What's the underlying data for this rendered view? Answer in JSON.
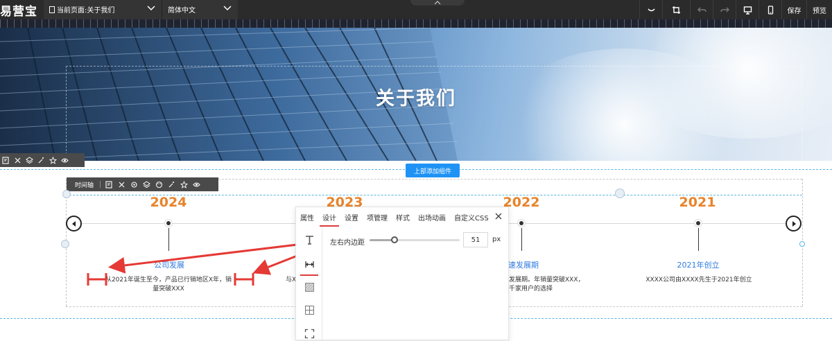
{
  "toolbar": {
    "logo": "易营宝",
    "current_page": "当前页面:关于我们",
    "language": "简体中文",
    "save": "保存",
    "preview": "预览",
    "tools": [
      "collapse-icon",
      "crop-icon",
      "undo-icon",
      "redo-icon",
      "desktop-icon",
      "mobile-icon"
    ]
  },
  "banner": {
    "title": "关于我们"
  },
  "add_component_button": "上部添加组件",
  "timeline_toolbar": {
    "label": "时间轴"
  },
  "timeline": {
    "events": [
      {
        "year": "2024",
        "title": "公司发展",
        "desc": "从2021年诞生至今，产品已行销地区X年，销量突破XXX"
      },
      {
        "year": "2023",
        "title": "",
        "desc": "与X"
      },
      {
        "year": "2022",
        "title": "速发展期",
        "desc": "发展期。年销量突破XXX，千家用户的选择"
      },
      {
        "year": "2021",
        "title": "2021年创立",
        "desc": "XXXX公司由XXXX先生于2021年创立"
      }
    ],
    "accent_color": "#e8832a",
    "title_color": "#2e7be0"
  },
  "panel": {
    "tabs": [
      "属性",
      "设计",
      "设置",
      "项管理",
      "样式",
      "出场动画",
      "自定义CSS"
    ],
    "active_tab": "设计",
    "property_label": "左右内边距",
    "property_value": "51",
    "property_unit": "px",
    "slider_fraction": 0.28,
    "side_tools": [
      "text-icon",
      "padding-icon",
      "background-icon",
      "border-icon",
      "margin-icon"
    ]
  },
  "annotation_color": "#e53935"
}
